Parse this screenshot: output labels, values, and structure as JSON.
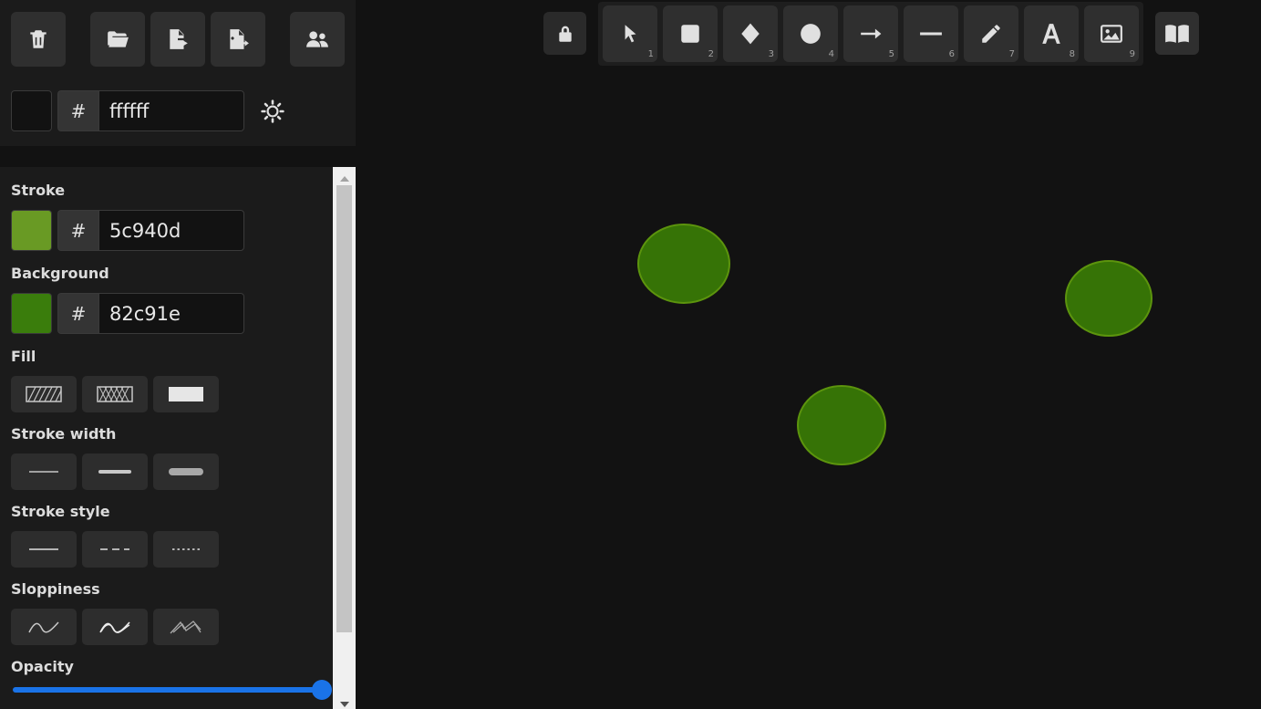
{
  "canvas_bg": "#121212",
  "top_menu": {
    "buttons": [
      {
        "name": "clear-canvas-button",
        "icon": "trash-icon"
      },
      {
        "name": "open-button",
        "icon": "folder-open-icon"
      },
      {
        "name": "export-button",
        "icon": "file-export-icon"
      },
      {
        "name": "export-image-button",
        "icon": "file-image-icon"
      },
      {
        "name": "collaborate-button",
        "icon": "users-icon"
      }
    ],
    "canvas_background": {
      "swatch": "#121212",
      "hash": "#",
      "hex": "ffffff"
    },
    "theme_toggle_icon": "sun-icon"
  },
  "properties": {
    "stroke": {
      "label": "Stroke",
      "swatch": "#699a24",
      "hash": "#",
      "hex": "5c940d"
    },
    "background": {
      "label": "Background",
      "swatch": "#3a7d0c",
      "hash": "#",
      "hex": "82c91e"
    },
    "fill": {
      "label": "Fill",
      "options": [
        "hachure-icon",
        "cross-hatch-icon",
        "solid-icon"
      ]
    },
    "stroke_width": {
      "label": "Stroke width",
      "options": [
        "thin-icon",
        "bold-icon",
        "extra-bold-icon"
      ]
    },
    "stroke_style": {
      "label": "Stroke style",
      "options": [
        "solid-line-icon",
        "dashed-line-icon",
        "dotted-line-icon"
      ]
    },
    "sloppiness": {
      "label": "Sloppiness",
      "options": [
        "architect-icon",
        "artist-icon",
        "cartoonist-icon"
      ]
    },
    "opacity": {
      "label": "Opacity",
      "value": 100
    }
  },
  "toolbar": {
    "lock_icon": "lock-icon",
    "tools": [
      {
        "name": "selection",
        "icon": "pointer-icon",
        "key": "1"
      },
      {
        "name": "rectangle",
        "icon": "square-icon",
        "key": "2"
      },
      {
        "name": "diamond",
        "icon": "diamond-icon",
        "key": "3"
      },
      {
        "name": "ellipse",
        "icon": "circle-icon",
        "key": "4"
      },
      {
        "name": "arrow",
        "icon": "arrow-icon",
        "key": "5"
      },
      {
        "name": "line",
        "icon": "line-icon",
        "key": "6"
      },
      {
        "name": "draw",
        "icon": "pencil-icon",
        "key": "7"
      },
      {
        "name": "text",
        "icon": "text-icon",
        "key": "8"
      },
      {
        "name": "image",
        "icon": "image-icon",
        "key": "9"
      }
    ],
    "library_icon": "book-icon"
  },
  "ellipses": {
    "fill": "#367306",
    "stroke": "#5c940d",
    "count": 3
  }
}
